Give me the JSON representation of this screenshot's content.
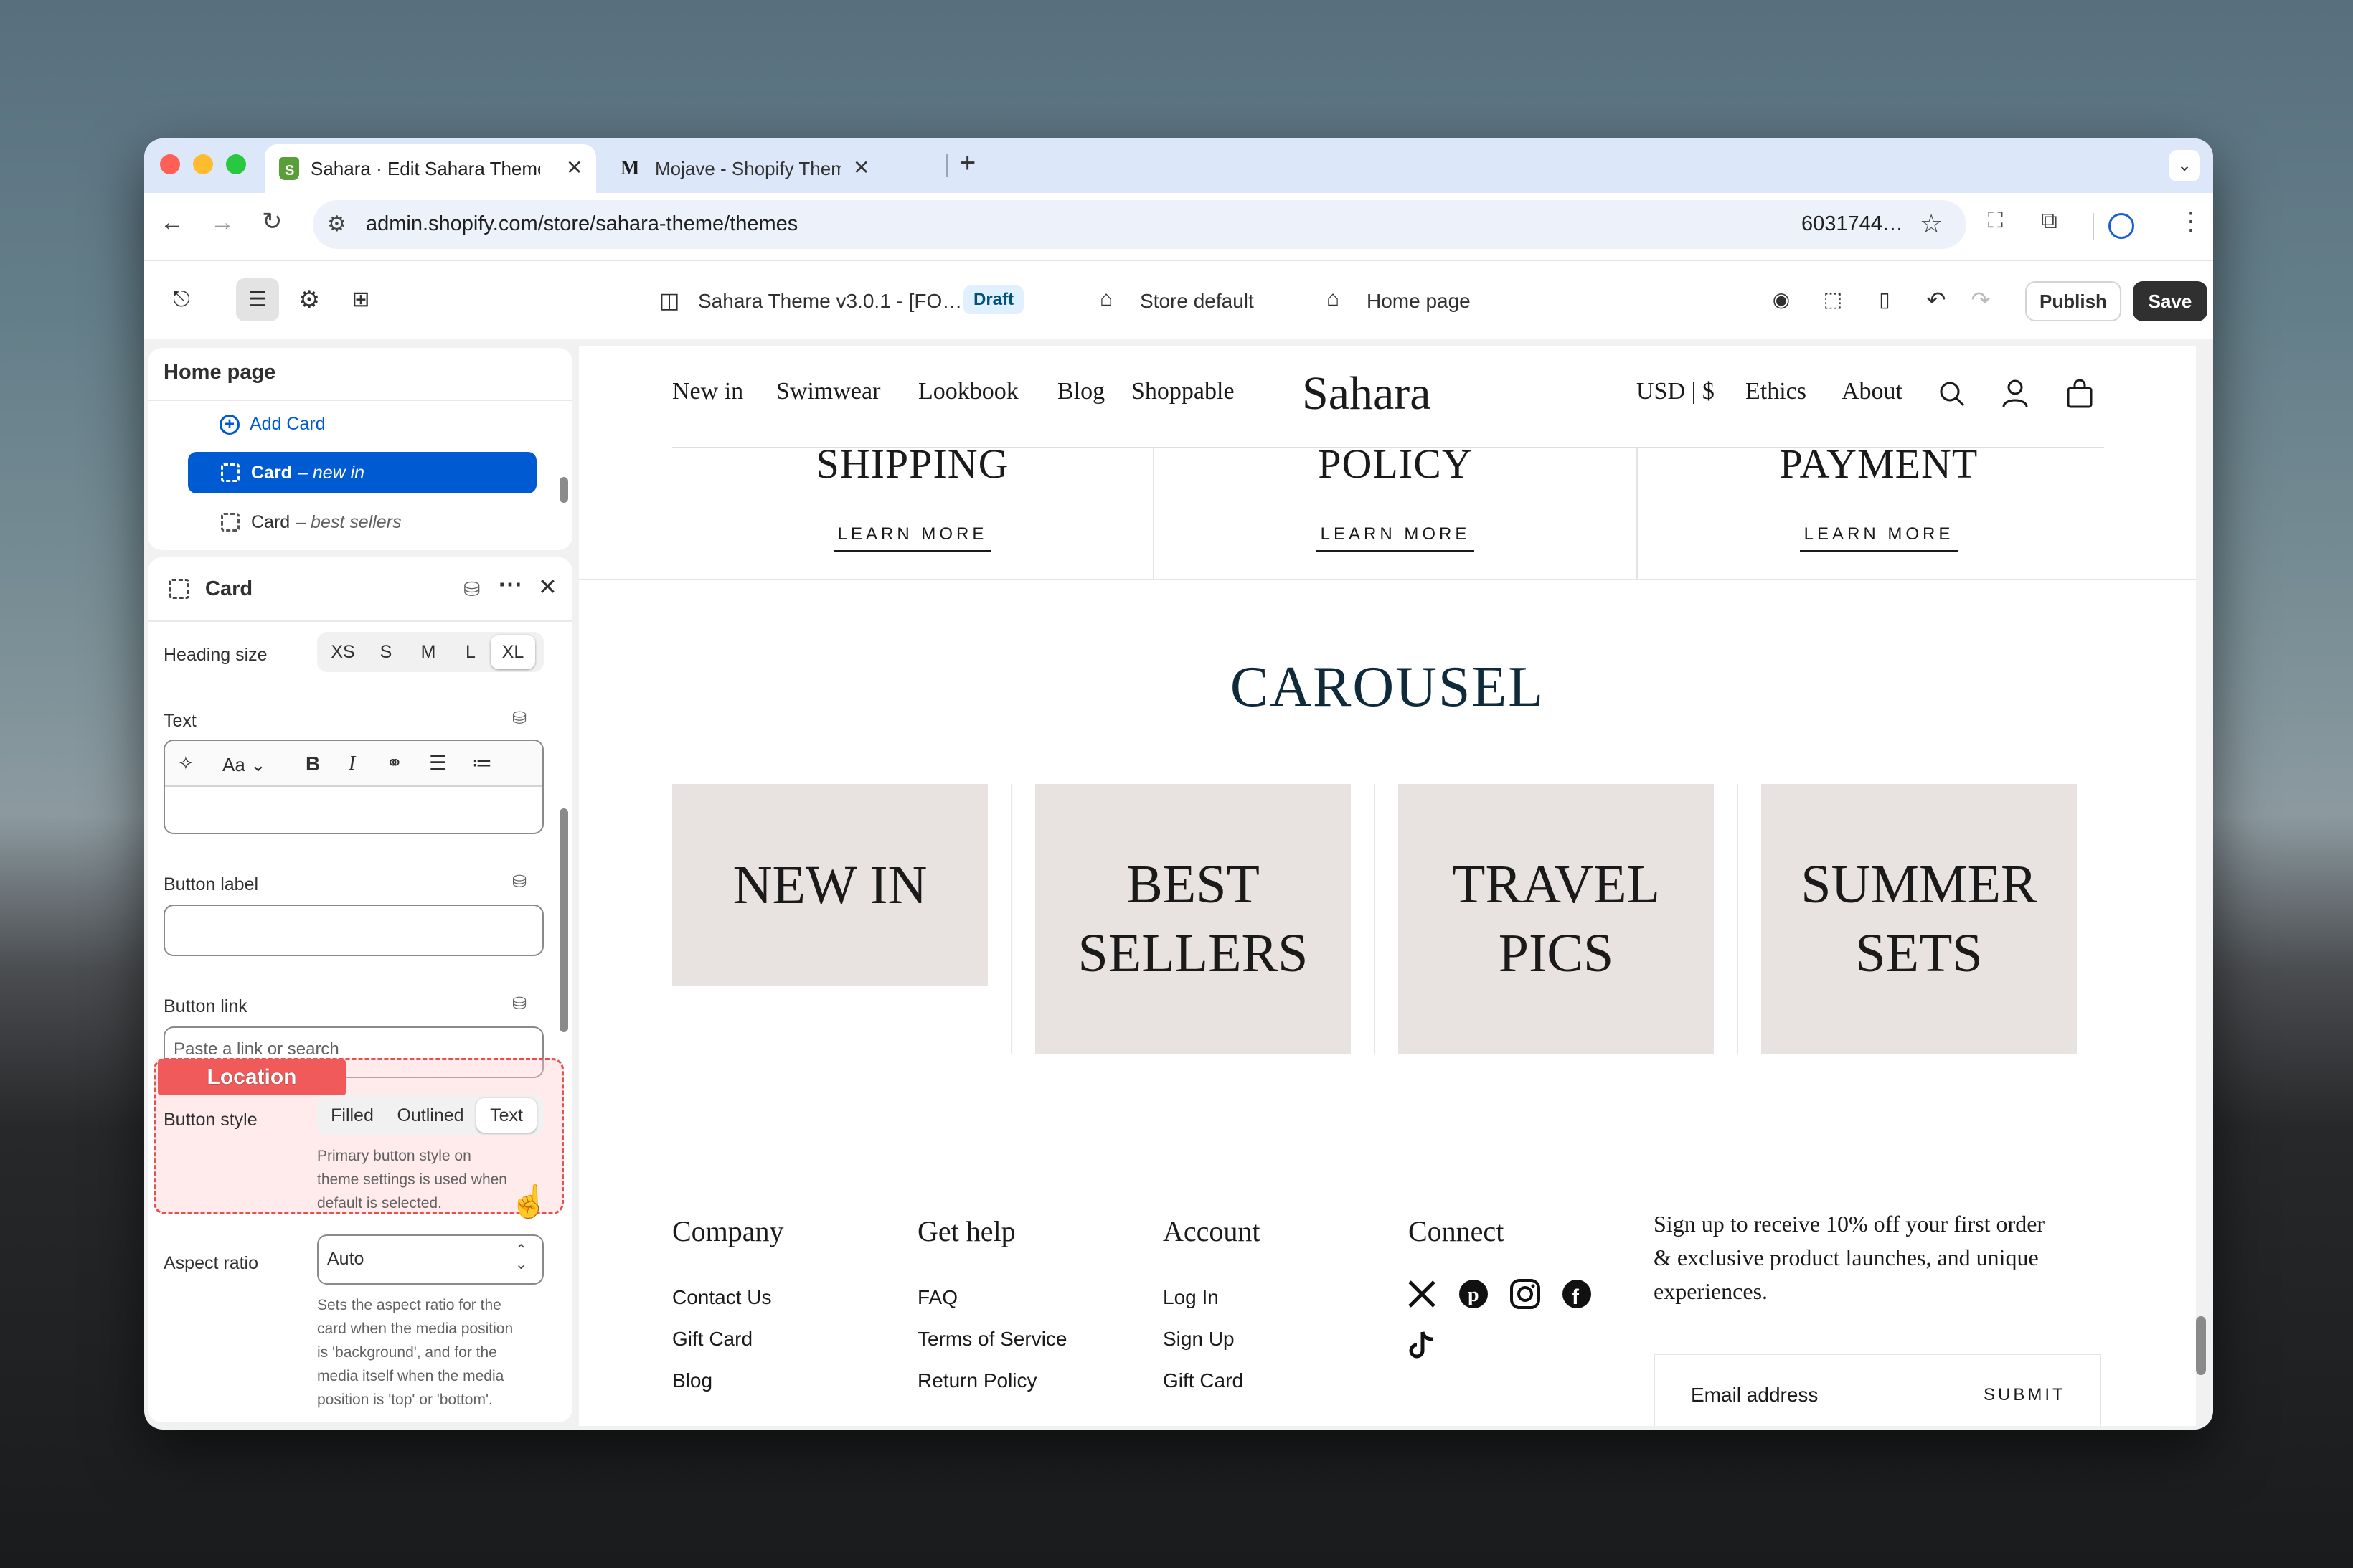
{
  "browser": {
    "tabs": [
      {
        "title": "Sahara · Edit Sahara Theme w",
        "favicon": "shopify-icon",
        "active": true
      },
      {
        "title": "Mojave - Shopify Theme by D",
        "favicon": "M",
        "active": false
      }
    ],
    "new_tab": "+",
    "url": "admin.shopify.com/store/sahara-theme/themes",
    "url_extra": "6031744…"
  },
  "editor": {
    "theme_name": "Sahara Theme v3.0.1 - [FO…",
    "status_badge": "Draft",
    "store_label": "Store default",
    "page_label": "Home page",
    "publish": "Publish",
    "save": "Save"
  },
  "sidebar": {
    "title": "Home page",
    "add_card": "Add Card",
    "items": [
      {
        "label": "Card",
        "sub": "– new in",
        "selected": true
      },
      {
        "label": "Card",
        "sub": "– best sellers",
        "selected": false
      }
    ]
  },
  "settings": {
    "title": "Card",
    "heading_size_label": "Heading size",
    "heading_sizes": [
      "XS",
      "S",
      "M",
      "L",
      "XL"
    ],
    "heading_size_selected": "XL",
    "text_label": "Text",
    "button_label_label": "Button label",
    "button_link_label": "Button link",
    "button_link_placeholder": "Paste a link or search",
    "button_style_label": "Button style",
    "button_styles": [
      "Filled",
      "Outlined",
      "Text"
    ],
    "button_style_selected": "Text",
    "button_style_help": [
      "Primary button style on",
      "theme settings is used when",
      "default is selected."
    ],
    "aspect_ratio_label": "Aspect ratio",
    "aspect_ratio_value": "Auto",
    "aspect_ratio_help": [
      "Sets the aspect ratio for the",
      "card when the media position",
      "is 'background', and for the",
      "media itself when the media",
      "position is 'top' or 'bottom'."
    ]
  },
  "annotation": {
    "label": "Location",
    "color": "#f05a5a"
  },
  "store": {
    "nav_left": [
      "New in",
      "Swimwear",
      "Lookbook",
      "Blog",
      "Shoppable"
    ],
    "logo": "Sahara",
    "nav_right": [
      "USD | $",
      "Ethics",
      "About"
    ],
    "features": [
      {
        "heading": "SHIPPING",
        "link": "LEARN MORE"
      },
      {
        "heading": "POLICY",
        "link": "LEARN MORE"
      },
      {
        "heading": "PAYMENT",
        "link": "LEARN MORE"
      }
    ],
    "carousel_title": "CAROUSEL",
    "cards": [
      [
        "NEW IN"
      ],
      [
        "BEST",
        "SELLERS"
      ],
      [
        "TRAVEL",
        "PICS"
      ],
      [
        "SUMMER",
        "SETS"
      ]
    ],
    "footer": {
      "columns": [
        {
          "title": "Company",
          "links": [
            "Contact Us",
            "Gift Card",
            "Blog"
          ]
        },
        {
          "title": "Get help",
          "links": [
            "FAQ",
            "Terms of Service",
            "Return Policy"
          ]
        },
        {
          "title": "Account",
          "links": [
            "Log In",
            "Sign Up",
            "Gift Card"
          ]
        }
      ],
      "connect_title": "Connect",
      "social": [
        "x-icon",
        "pinterest-icon",
        "instagram-icon",
        "facebook-icon",
        "tiktok-icon"
      ],
      "newsletter_lines": [
        "Sign up to receive 10% off your first order",
        "& exclusive product launches, and unique",
        "experiences."
      ],
      "email_placeholder": "Email address",
      "submit": "SUBMIT"
    }
  },
  "colors": {
    "accent": "#005bd3",
    "heading_teal": "#0f2a3a",
    "card_bg": "#e8e2e1",
    "badge_bg": "#e0f0ff"
  }
}
